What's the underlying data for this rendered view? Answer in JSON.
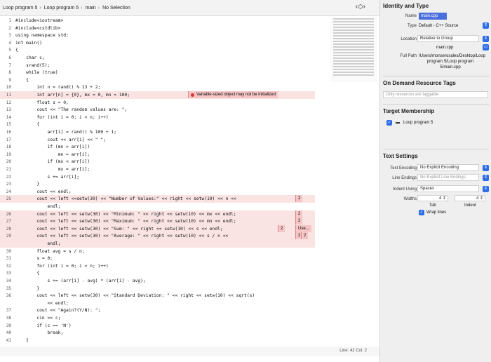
{
  "editor": {
    "breadcrumb": [
      "Loop program 5",
      "Loop program 5",
      "main",
      "No Selection"
    ],
    "nav_glyph": "‹◇›",
    "error_message": "Variable-sized object may not be initialized",
    "error_counts": [
      "2",
      "2",
      "2",
      "2",
      "2",
      "2"
    ],
    "error_use": "Use...",
    "status_position": "Line: 42  Col: 2",
    "lines": [
      {
        "n": "1",
        "text": "#include<iostream>"
      },
      {
        "n": "2",
        "text": "#include<cstdlib>"
      },
      {
        "n": "3",
        "text": "using namespace std;"
      },
      {
        "n": "4",
        "text": "int main()"
      },
      {
        "n": "5",
        "text": "{"
      },
      {
        "n": "6",
        "text": "    char c;"
      },
      {
        "n": "7",
        "text": "    srand(5);"
      },
      {
        "n": "8",
        "text": "    while (true)"
      },
      {
        "n": "9",
        "text": "    {"
      },
      {
        "n": "10",
        "text": "        int n = rand() % 13 + 2;"
      },
      {
        "n": "11",
        "text": "        int arr[n] = {0}, mx = 0, mn = 100;"
      },
      {
        "n": "12",
        "text": "        float s = 0;"
      },
      {
        "n": "13",
        "text": "        cout << \"The random values are: \";"
      },
      {
        "n": "14",
        "text": "        for (int i = 0; i < n; i++)"
      },
      {
        "n": "15",
        "text": "        {"
      },
      {
        "n": "16",
        "text": "            arr[i] = rand() % 100 + 1;"
      },
      {
        "n": "17",
        "text": "            cout << arr[i] << \" \";"
      },
      {
        "n": "18",
        "text": "            if (mn > arr[i])"
      },
      {
        "n": "19",
        "text": "                mn = arr[i];"
      },
      {
        "n": "20",
        "text": "            if (mx < arr[i])"
      },
      {
        "n": "21",
        "text": "                mx = arr[i];"
      },
      {
        "n": "22",
        "text": "            s += arr[i];"
      },
      {
        "n": "23",
        "text": "        }"
      },
      {
        "n": "24",
        "text": "        cout << endl;"
      },
      {
        "n": "25",
        "text": "        cout << left <<setw(30) << \"Number of Values:\" << right << setw(10) << n <<"
      },
      {
        "n": "",
        "text": "            endl;"
      },
      {
        "n": "26",
        "text": "        cout << left << setw(30) << \"Minimum: \" << right << setw(10) << mx << endl;"
      },
      {
        "n": "27",
        "text": "        cout << left << setw(30) << \"Maximum: \" << right << setw(10) << mn << endl;"
      },
      {
        "n": "28",
        "text": "        cout << left << setw(30) << \"Sum: \" << right << setw(10) << s << endl;"
      },
      {
        "n": "29",
        "text": "        cout << left << setw(30) << \"Average: \" << right << setw(10) << s / n <<"
      },
      {
        "n": "",
        "text": "            endl;"
      },
      {
        "n": "30",
        "text": "        float avg = s / n;"
      },
      {
        "n": "31",
        "text": "        s = 0;"
      },
      {
        "n": "32",
        "text": "        for (int i = 0; i < n; i++)"
      },
      {
        "n": "33",
        "text": "        {"
      },
      {
        "n": "34",
        "text": "            s += (arr[i] - avg) * (arr[i] - avg);"
      },
      {
        "n": "35",
        "text": "        }"
      },
      {
        "n": "36",
        "text": "        cout << left << setw(30) << \"Standard Deviation: \" << right << setw(10) << sqrt(s)"
      },
      {
        "n": "",
        "text": "            << endl;"
      },
      {
        "n": "37",
        "text": "        cout << \"Again?(Y/N): \";"
      },
      {
        "n": "38",
        "text": "        cin >> c;"
      },
      {
        "n": "39",
        "text": "        if (c == 'N')"
      },
      {
        "n": "40",
        "text": "            break;"
      },
      {
        "n": "41",
        "text": "    }"
      }
    ]
  },
  "inspector": {
    "identity_title": "Identity and Type",
    "name_label": "Name",
    "name_value": "main.cpp",
    "type_label": "Type",
    "type_value": "Default - C++ Source",
    "location_label": "Location",
    "location_value": "Relative to Group",
    "location_file": "main.cpp",
    "fullpath_label": "Full Path",
    "fullpath_value": "/Users/monserosales/Desktop/Loop program 5/Loop program 5/main.cpp",
    "odr_title": "On Demand Resource Tags",
    "odr_placeholder": "Only resources are taggable",
    "target_title": "Target Membership",
    "target_item": "Loop program 5",
    "text_title": "Text Settings",
    "encoding_label": "Text Encoding",
    "encoding_value": "No Explicit Encoding",
    "line_endings_label": "Line Endings",
    "line_endings_value": "No Explicit Line Endings",
    "indent_using_label": "Indent Using",
    "indent_using_value": "Spaces",
    "widths_label": "Widths",
    "tab_width": "4",
    "indent_width": "4",
    "tab_label": "Tab",
    "indent_label": "Indent",
    "wrap_label": "Wrap lines"
  },
  "colors": {
    "accent": "#2f6ee8",
    "error_bg": "#fae3e3",
    "keyword": "#a3207a"
  }
}
